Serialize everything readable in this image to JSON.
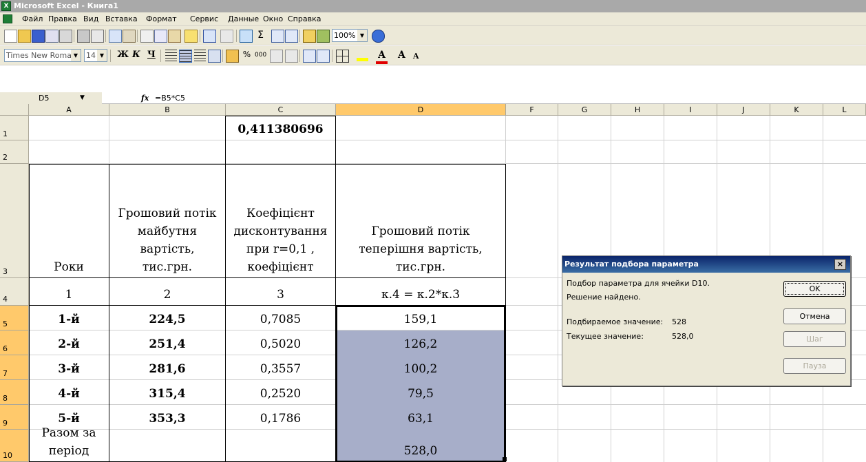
{
  "window": {
    "title": "Microsoft Excel - Книга1",
    "icon_letter": "X"
  },
  "menu": [
    "Файл",
    "Правка",
    "Вид",
    "Вставка",
    "Формат",
    "Сервис",
    "Данные",
    "Окно",
    "Справка"
  ],
  "toolbar": {
    "zoom": "100%"
  },
  "format_toolbar": {
    "font": "Times New Roman",
    "size": "14",
    "bold": "Ж",
    "italic": "К",
    "underline": "Ч",
    "percent": "%",
    "thousands": "000"
  },
  "formula_bar": {
    "cell_ref": "D5",
    "fx": "fx",
    "formula": "=B5*C5"
  },
  "columns": [
    "A",
    "B",
    "C",
    "D",
    "F",
    "G",
    "H",
    "I",
    "J",
    "K",
    "L"
  ],
  "rows": [
    "1",
    "2",
    "3",
    "4",
    "5",
    "6",
    "7",
    "8",
    "9",
    "10"
  ],
  "sheet": {
    "c1": "0,411380696",
    "header": {
      "a": "Роки",
      "b": [
        "Грошовий потік",
        "майбутня",
        "вартість,",
        "тис.грн."
      ],
      "c": [
        "Коефіцієнт",
        "дисконтування",
        "при r=0,1 ,",
        "коефіцієнт"
      ],
      "d": [
        "Грошовий потік",
        "теперішня вартість,",
        "тис.грн."
      ]
    },
    "numbering": [
      "1",
      "2",
      "3",
      "к.4 = к.2*к.3"
    ],
    "data": [
      {
        "year": "1-й",
        "fv": "224,5",
        "k": "0,7085",
        "pv": "159,1"
      },
      {
        "year": "2-й",
        "fv": "251,4",
        "k": "0,5020",
        "pv": "126,2"
      },
      {
        "year": "3-й",
        "fv": "281,6",
        "k": "0,3557",
        "pv": "100,2"
      },
      {
        "year": "4-й",
        "fv": "315,4",
        "k": "0,2520",
        "pv": "79,5"
      },
      {
        "year": "5-й",
        "fv": "353,3",
        "k": "0,1786",
        "pv": "63,1"
      }
    ],
    "total": {
      "label": [
        "Разом за",
        "період"
      ],
      "pv": "528,0"
    }
  },
  "dialog": {
    "title": "Результат подбора параметра",
    "close": "×",
    "line1": "Подбор параметра для ячейки D10.",
    "line2": "Решение найдено.",
    "target_label": "Подбираемое значение:",
    "target_value": "528",
    "current_label": "Текущее значение:",
    "current_value": "528,0",
    "buttons": {
      "ok": "OK",
      "cancel": "Отмена",
      "step": "Шаг",
      "pause": "Пауза"
    }
  }
}
